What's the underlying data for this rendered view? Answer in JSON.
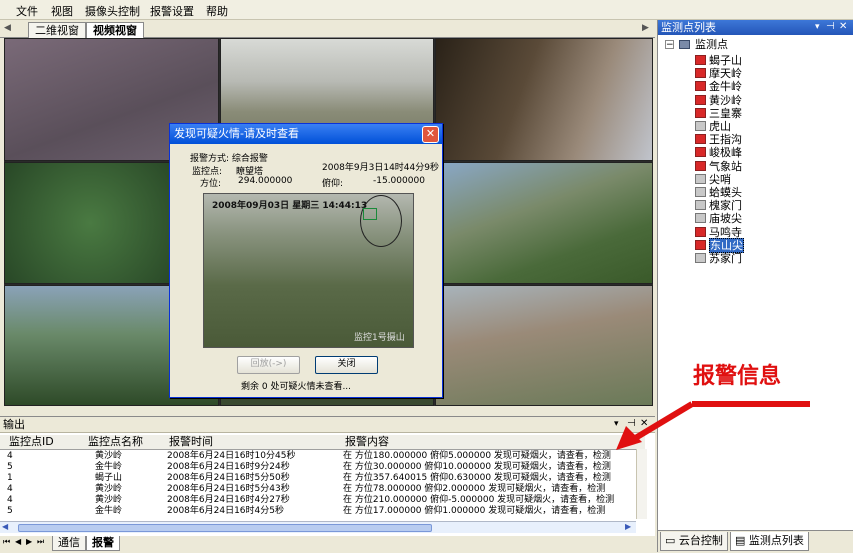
{
  "menu": [
    "文件",
    "视图",
    "摄像头控制",
    "报警设置",
    "帮助"
  ],
  "tabs": [
    "二维视窗",
    "视频视窗"
  ],
  "dialog": {
    "title": "发现可疑火情-请及时查看",
    "alarm_method": "报警方式: 综合报警",
    "monitor_point": "监控点:",
    "monitor_point_value": "瞭望塔",
    "datetime": "2008年9月3日14时44分9秒",
    "azimuth_label": "方位:",
    "azimuth_value": "294.000000",
    "pitch_label": "俯仰:",
    "pitch_value": "-15.000000",
    "image_timestamp": "2008年09月03日  星期三  14:44:13",
    "image_caption": "监控1号摄山",
    "replay_button": "回放(->)",
    "close_button": "关闭",
    "remaining": "剩余 0 处可疑火情未查看..."
  },
  "right_panel": {
    "title": "监测点列表",
    "root": "监测点",
    "items": [
      "蝎子山",
      "摩天岭",
      "金牛岭",
      "黄沙岭",
      "三皇寨",
      "虎山",
      "王指沟",
      "峻极峰",
      "气象站",
      "尖哨",
      "蛤蟆头",
      "槐家门",
      "庙坡尖",
      "马鸣寺",
      "东山尖",
      "苏家门"
    ],
    "selected": "东山尖",
    "tabs": [
      "云台控制",
      "监测点列表"
    ]
  },
  "output": {
    "title": "输出",
    "columns": [
      "监控点ID",
      "监控点名称",
      "报警时间",
      "报警内容"
    ],
    "rows": [
      [
        "4",
        "黄沙岭",
        "2008年6月24日16时10分45秒",
        "在 方位180.000000 俯仰5.000000 发现可疑烟火，请查看，检测"
      ],
      [
        "5",
        "金牛岭",
        "2008年6月24日16时9分24秒",
        "在 方位30.000000 俯仰10.000000 发现可疑烟火，请查看，检测"
      ],
      [
        "1",
        "蝎子山",
        "2008年6月24日16时5分50秒",
        "在 方位357.640015 俯仰0.630000 发现可疑烟火，请查看，检测"
      ],
      [
        "4",
        "黄沙岭",
        "2008年6月24日16时5分43秒",
        "在 方位78.000000 俯仰2.000000 发现可疑烟火，请查看，检测"
      ],
      [
        "4",
        "黄沙岭",
        "2008年6月24日16时4分27秒",
        "在 方位210.000000 俯仰-5.000000 发现可疑烟火，请查看，检测"
      ],
      [
        "5",
        "金牛岭",
        "2008年6月24日16时4分5秒",
        "在 方位17.000000 俯仰1.000000 发现可疑烟火，请查看，检测"
      ]
    ],
    "bottom_tabs": [
      "通信",
      "报警"
    ]
  },
  "annotation": "报警信息",
  "colors": {
    "accent": "#0050d8",
    "annotation": "#e01010"
  }
}
